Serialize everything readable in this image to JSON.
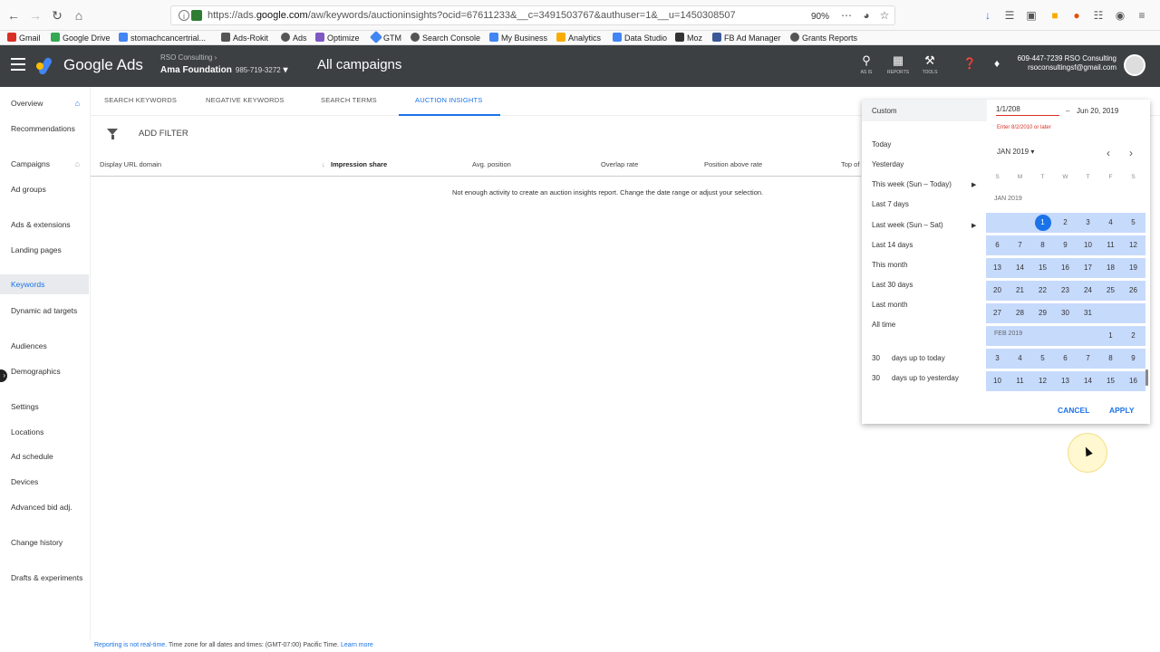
{
  "browser": {
    "url_prefix": "https://ads.",
    "url_host": "google.com",
    "url_path": "/aw/keywords/auctioninsights?ocid=67611233&__c=3491503767&authuser=1&__u=1450308507",
    "zoom": "90%"
  },
  "bookmarks": [
    {
      "label": "Gmail",
      "color": "#d93025"
    },
    {
      "label": "Google Drive",
      "color": "#34a853"
    },
    {
      "label": "stomachcancertrial...",
      "color": "#4285f4"
    },
    {
      "label": "Ads-Rokit",
      "color": "#555555"
    },
    {
      "label": "Ads",
      "color": "#555555"
    },
    {
      "label": "Optimize",
      "color": "#7e57c2"
    },
    {
      "label": "GTM",
      "color": "#4285f4"
    },
    {
      "label": "Search Console",
      "color": "#555555"
    },
    {
      "label": "My Business",
      "color": "#4285f4"
    },
    {
      "label": "Analytics",
      "color": "#f9ab00"
    },
    {
      "label": "Data Studio",
      "color": "#4285f4"
    },
    {
      "label": "Moz",
      "color": "#333333"
    },
    {
      "label": "FB Ad Manager",
      "color": "#3b5998"
    },
    {
      "label": "Grants Reports",
      "color": "#555555"
    }
  ],
  "header": {
    "product": "Google Ads",
    "account_sub": "RSO Consulting",
    "account_name": "Ama Foundation",
    "account_id": "985-719-3272",
    "page_title": "All campaigns",
    "icons": [
      {
        "icon": "search-icon",
        "label": "AS IS"
      },
      {
        "icon": "reports-icon",
        "label": "REPORTS"
      },
      {
        "icon": "tools-icon",
        "label": "TOOLS"
      }
    ],
    "contact_phone": "609-447-7239 RSO Consulting",
    "contact_email": "rsoconsultingsf@gmail.com"
  },
  "sidebar": {
    "items": [
      {
        "label": "Overview"
      },
      {
        "label": "Recommendations"
      },
      {
        "label": "Campaigns"
      },
      {
        "label": "Ad groups"
      },
      {
        "label": "Ads & extensions"
      },
      {
        "label": "Landing pages"
      },
      {
        "label": "Keywords"
      },
      {
        "label": "Dynamic ad targets"
      },
      {
        "label": "Audiences"
      },
      {
        "label": "Demographics"
      },
      {
        "label": "Settings"
      },
      {
        "label": "Locations"
      },
      {
        "label": "Ad schedule"
      },
      {
        "label": "Devices"
      },
      {
        "label": "Advanced bid adj."
      },
      {
        "label": "Change history"
      },
      {
        "label": "Drafts & experiments"
      }
    ]
  },
  "tabs": [
    {
      "label": "SEARCH KEYWORDS"
    },
    {
      "label": "NEGATIVE KEYWORDS"
    },
    {
      "label": "SEARCH TERMS"
    },
    {
      "label": "AUCTION INSIGHTS"
    }
  ],
  "filter": {
    "label": "ADD FILTER"
  },
  "table": {
    "columns": [
      "Display URL domain",
      "Impression share",
      "Avg. position",
      "Overlap rate",
      "Position above rate",
      "Top of"
    ],
    "empty_message": "Not enough activity to create an auction insights report. Change the date range or adjust your selection."
  },
  "footer": {
    "link1": "Reporting is not real-time.",
    "text": " Time zone for all dates and times: (GMT-07:00) Pacific Time. ",
    "link2": "Learn more"
  },
  "datepicker": {
    "custom_label": "Custom",
    "presets": [
      {
        "label": "Today",
        "arrow": false
      },
      {
        "label": "Yesterday",
        "arrow": false
      },
      {
        "label": "This week (Sun – Today)",
        "arrow": true
      },
      {
        "label": "Last 7 days",
        "arrow": false
      },
      {
        "label": "Last week (Sun – Sat)",
        "arrow": true
      },
      {
        "label": "Last 14 days",
        "arrow": false
      },
      {
        "label": "This month",
        "arrow": false
      },
      {
        "label": "Last 30 days",
        "arrow": false
      },
      {
        "label": "Last month",
        "arrow": false
      },
      {
        "label": "All time",
        "arrow": false
      }
    ],
    "days_up_to_today_num": "30",
    "days_up_to_today": "days up to today",
    "days_up_to_yesterday_num": "30",
    "days_up_to_yesterday": "days up to yesterday",
    "start_date": "1/1/208",
    "date_error": "Enter 8/2/2010 or later",
    "dash": "–",
    "end_date": "Jun 20, 2019",
    "month_select": "JAN 2019",
    "weekdays": [
      "S",
      "M",
      "T",
      "W",
      "T",
      "F",
      "S"
    ],
    "jan_label": "JAN 2019",
    "feb_label": "FEB 2019",
    "cancel": "CANCEL",
    "apply": "APPLY"
  }
}
